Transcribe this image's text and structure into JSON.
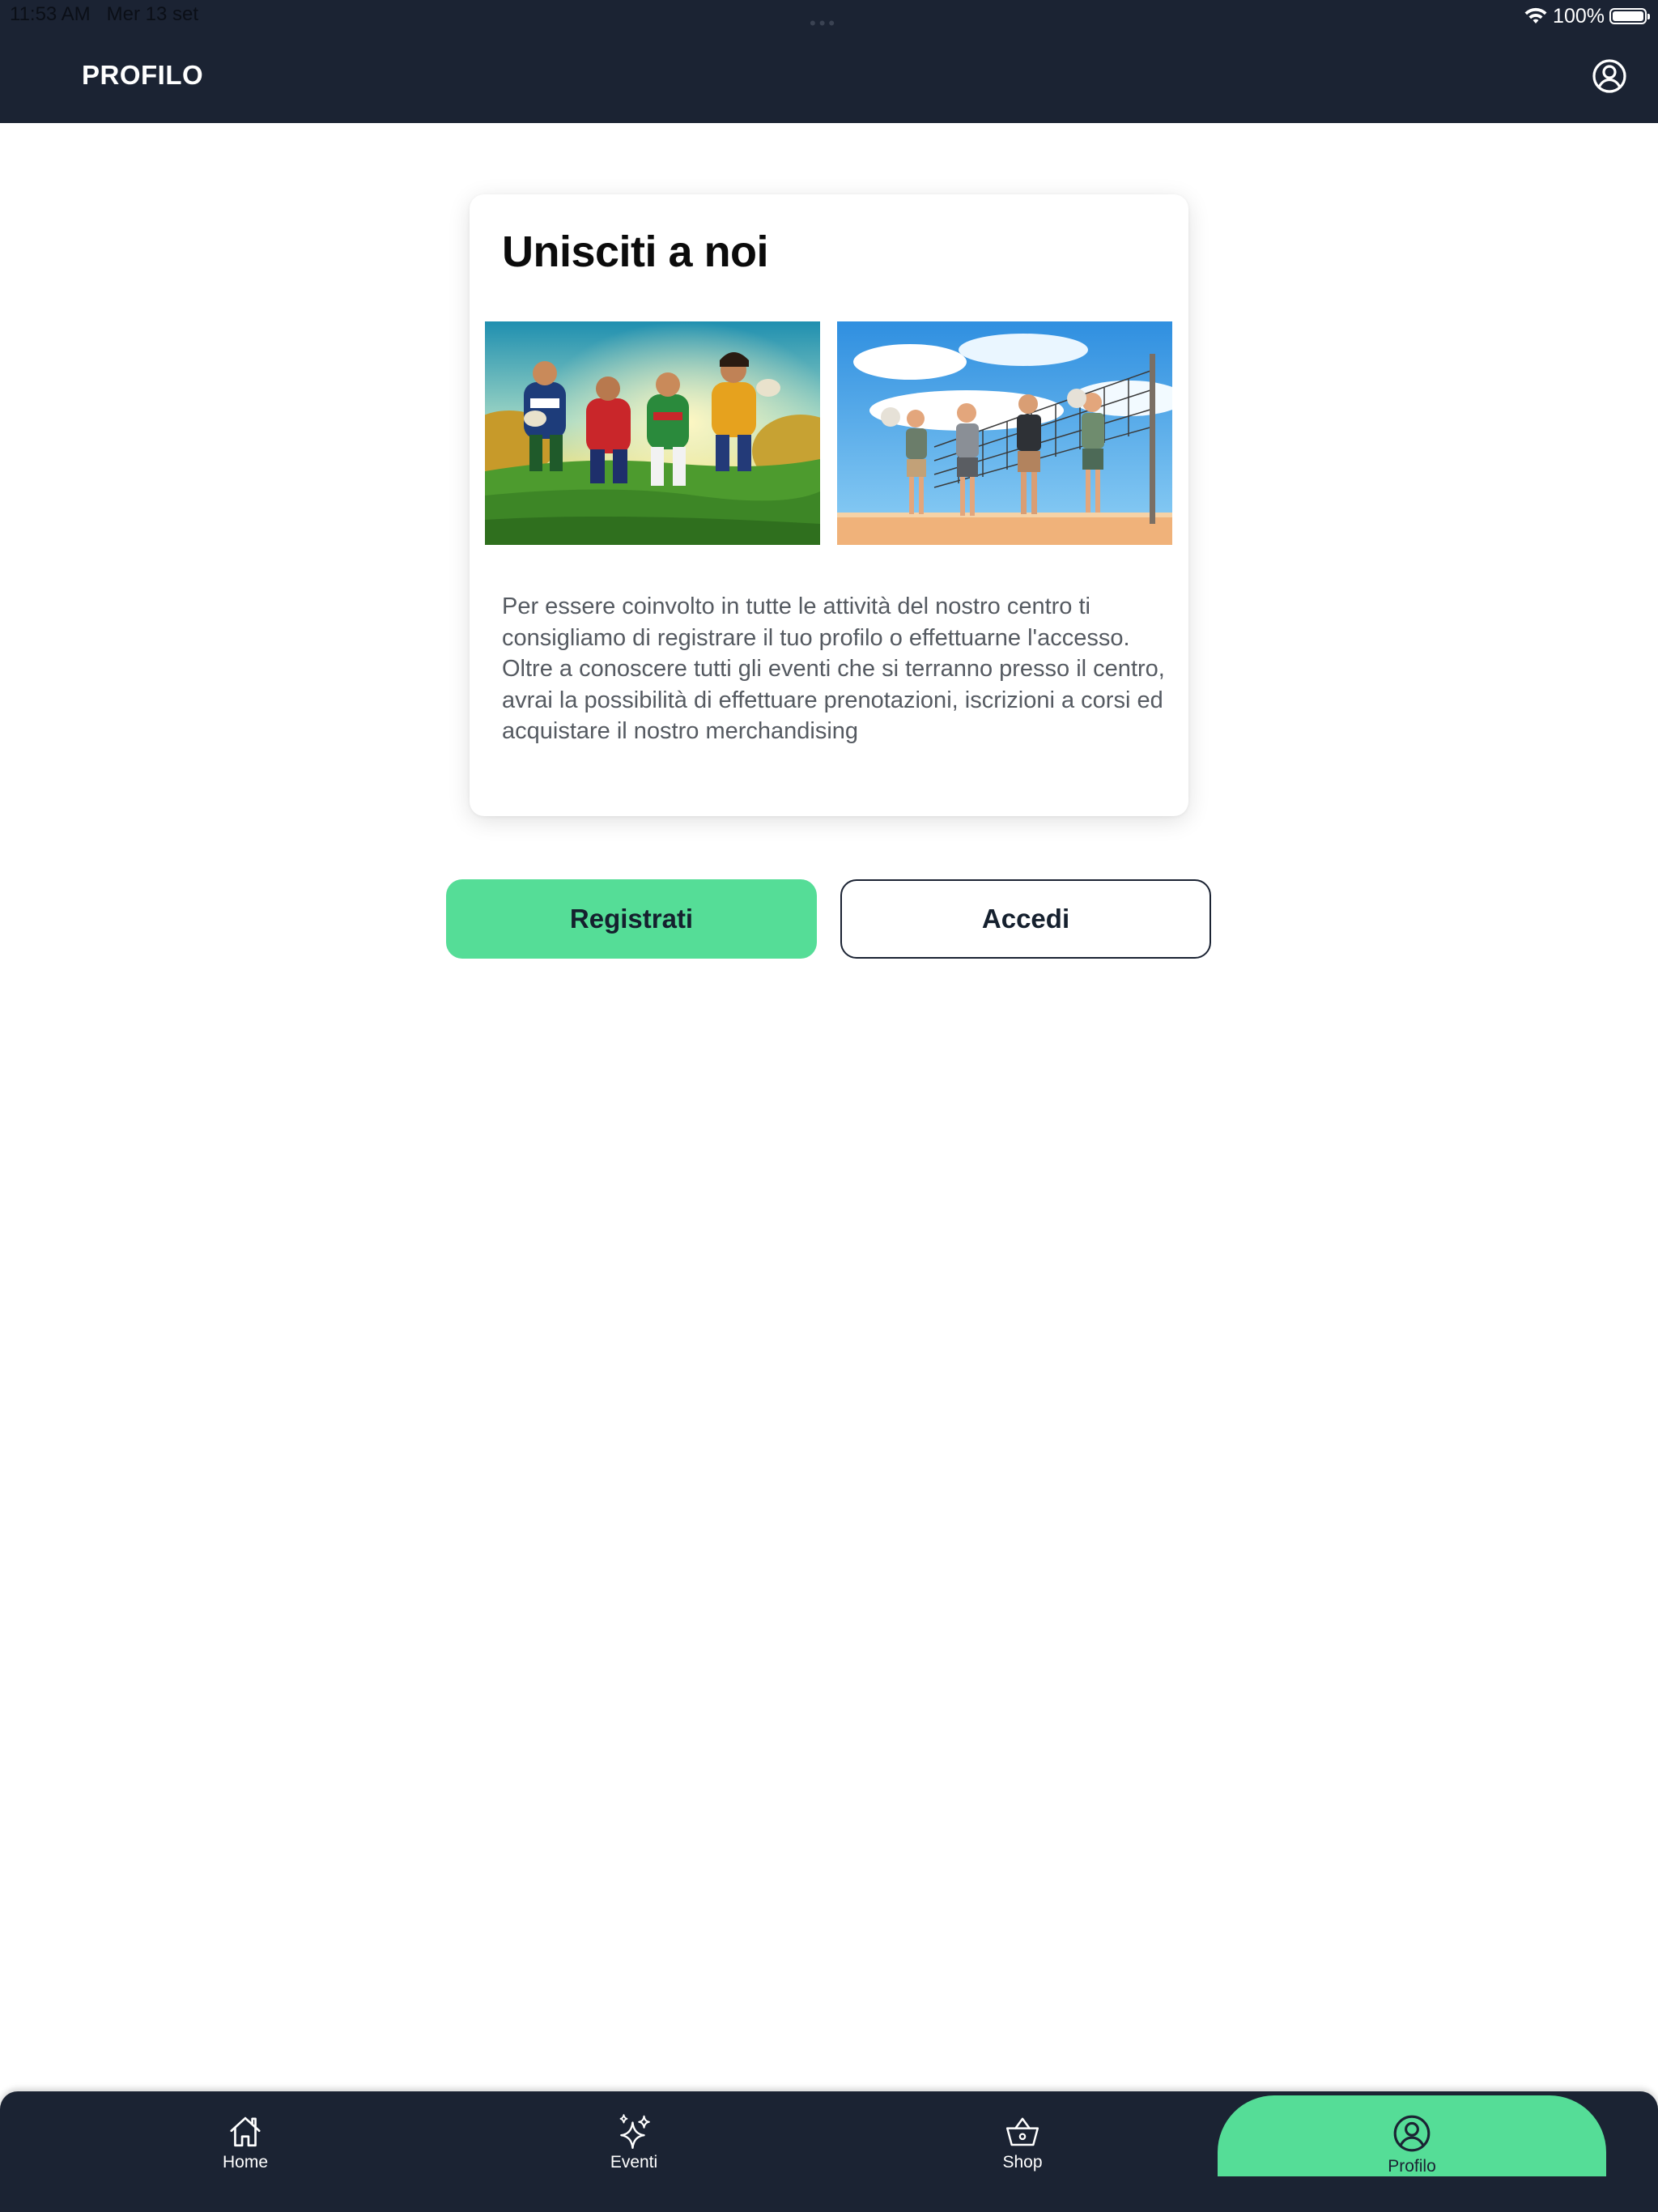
{
  "status_bar": {
    "time": "11:53 AM",
    "date": "Mer 13 set",
    "battery": "100%"
  },
  "header": {
    "title": "PROFILO"
  },
  "card": {
    "title": "Unisciti a noi",
    "paragraph1": "Per essere coinvolto in tutte le attività del nostro centro ti consigliamo di registrare il tuo profilo o effettuarne l'accesso.",
    "paragraph2": "Oltre a conoscere tutti gli eventi che si terranno presso il centro, avrai la possibilità di effettuare prenotazioni, iscrizioni a corsi ed acquistare il nostro merchandising"
  },
  "buttons": {
    "register": "Registrati",
    "login": "Accedi"
  },
  "nav": {
    "items": [
      {
        "label": "Home",
        "icon": "home-icon"
      },
      {
        "label": "Eventi",
        "icon": "sparkles-icon"
      },
      {
        "label": "Shop",
        "icon": "basket-icon"
      },
      {
        "label": "Profilo",
        "icon": "user-circle-icon"
      }
    ],
    "active": "Profilo"
  },
  "colors": {
    "header_bg": "#1b2333",
    "accent": "#55dd97",
    "text_muted": "#555a61"
  }
}
